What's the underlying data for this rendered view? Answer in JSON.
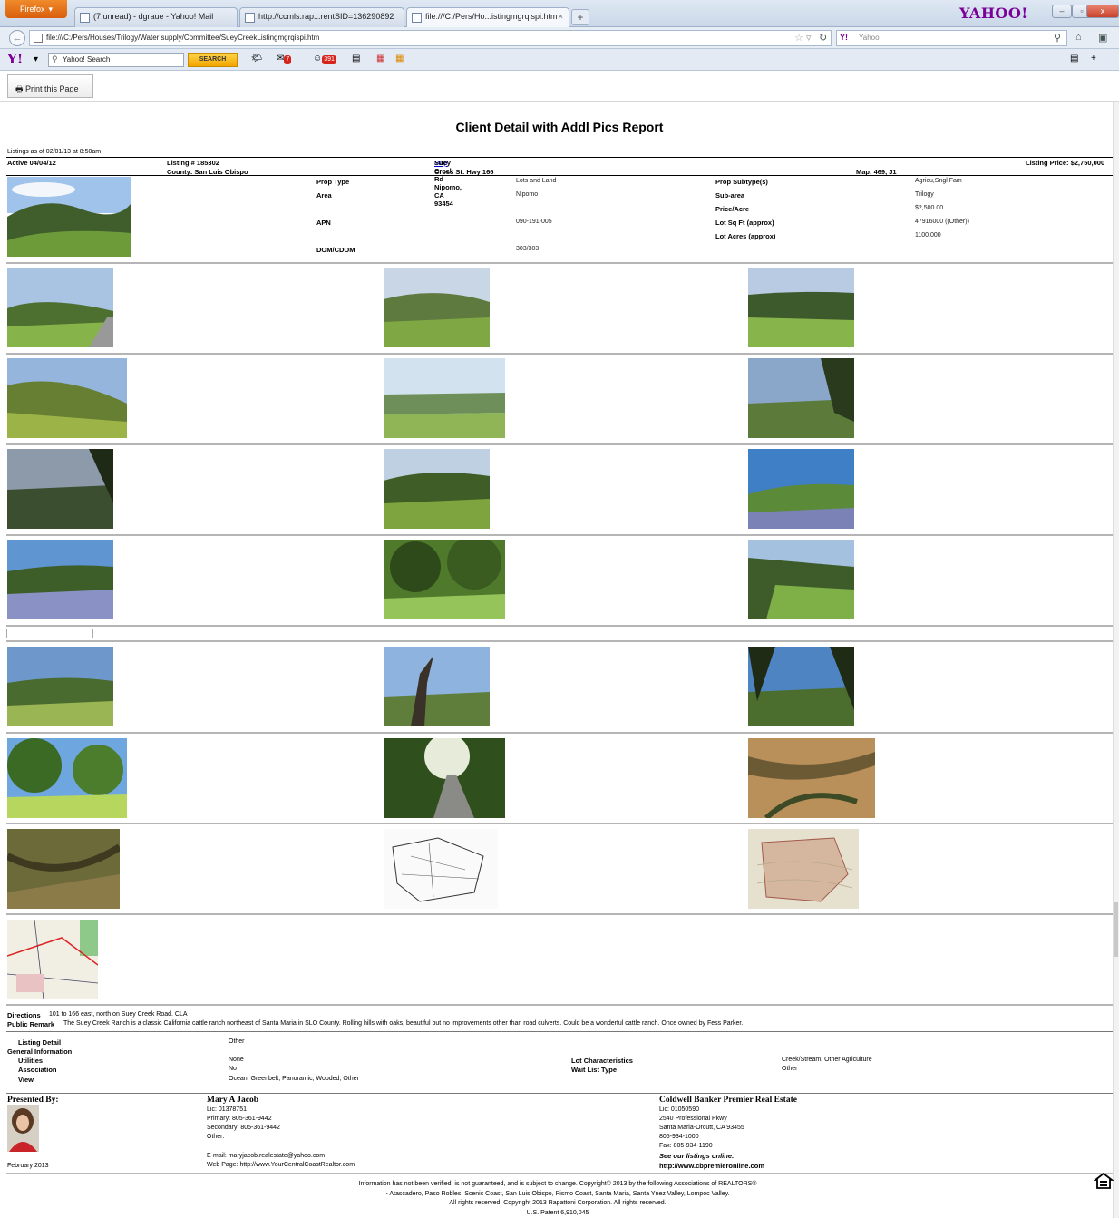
{
  "browser": {
    "firefox_label": "Firefox",
    "tabs": [
      {
        "label": "(7 unread) - dgraue - Yahoo! Mail"
      },
      {
        "label": "http://ccmls.rap...rentSID=136290892"
      },
      {
        "label": "file:///C:/Pers/Ho...istingmgrqispi.htm"
      }
    ],
    "new_tab": "+",
    "brand": "YAHOO!",
    "window_controls": {
      "minimize": "–",
      "restore": "▫",
      "close": "x"
    },
    "url": "file:///C:/Pers/Houses/Trilogy/Water supply/Committee/SueyCreekListingmgrqispi.htm",
    "search_placeholder": "Yahoo",
    "search_prefix": "Y!"
  },
  "yahoo_toolbar": {
    "logo": "Y!",
    "search_value": "Yahoo! Search",
    "search_button": "SEARCH",
    "mail_badge": "7",
    "count_badge": "391"
  },
  "print_button": "Print this Page",
  "report": {
    "title": "Client Detail with Addl Pics Report",
    "as_of": "Listings as of 02/01/13 at 8:50am",
    "status": "Active 04/04/12",
    "listing_no": "Listing # 185302",
    "county": "County: San Luis Obispo",
    "address": "Suey Creek Rd Nipomo, CA 93454",
    "map_link": "Map",
    "cross_st": "Cross St: Hwy 166",
    "map_ref": "Map: 469, J1",
    "price": "Listing Price: $2,750,000"
  },
  "details": {
    "left": [
      {
        "label": "Prop Type",
        "value": "Lots and Land"
      },
      {
        "label": "Area",
        "value": "Nipomo"
      },
      {
        "label": "APN",
        "value": "090-191-005"
      },
      {
        "label": "DOM/CDOM",
        "value": "303/303"
      }
    ],
    "right": [
      {
        "label": "Prop Subtype(s)",
        "value": "Agricu,Sngl Fam"
      },
      {
        "label": "Sub-area",
        "value": "Trilogy"
      },
      {
        "label": "Price/Acre",
        "value": "$2,500.00"
      },
      {
        "label": "Lot Sq Ft (approx)",
        "value": "47916000 ((Other))"
      },
      {
        "label": "Lot Acres (approx)",
        "value": "1100.000"
      }
    ]
  },
  "remarks": {
    "directions_label": "Directions",
    "directions": "101 to 166 east, north on Suey Creek Road. CLA",
    "public_label": "Public Remark",
    "public": "The Suey Creek Ranch is a classic California cattle ranch northeast of Santa Maria in SLO County. Rolling hills with oaks, beautiful but no improvements other than road culverts. Could be a wonderful cattle ranch. Once owned by Fess Parker."
  },
  "listing_detail": {
    "heading": "Listing Detail",
    "heading_value": "Other",
    "general": "General Information",
    "utilities_label": "Utilities",
    "utilities": "None",
    "association_label": "Association",
    "association": "No",
    "view_label": "View",
    "view": "Ocean, Greenbelt, Panoramic, Wooded, Other",
    "lot_char_label": "Lot Characteristics",
    "lot_char": "Creek/Stream, Other Agriculture",
    "wait_list_label": "Wait List Type",
    "wait_list": "Other"
  },
  "agent": {
    "presented_by": "Presented By:",
    "date": "February 2013",
    "name": "Mary A Jacob",
    "lic": "Lic: 01378751",
    "primary": "Primary: 805-361-9442",
    "secondary": "Secondary: 805-361-9442",
    "other": "Other:",
    "email": "E-mail: maryjacob.realestate@yahoo.com",
    "web": "Web Page: http://www.YourCentralCoastRealtor.com"
  },
  "office": {
    "name": "Coldwell Banker Premier Real Estate",
    "lic": "Lic: 01050590",
    "addr1": "2540 Professional Pkwy",
    "addr2": "Santa Maria-Orcutt, CA 93455",
    "phone": "805-934-1000",
    "fax": "Fax:  805-934-1190",
    "see": "See our listings online:",
    "url": "http://www.cbpremieronline.com"
  },
  "footer": {
    "line1": "Information has not been verified, is not guaranteed, and is subject to change. Copyright© 2013 by the following Associations of REALTORS®",
    "line2": "- Atascadero, Paso Robles, Scenic Coast, San Luis Obispo, Pismo Coast, Santa Maria, Santa Ynez Valley, Lompoc Valley.",
    "line3": "All rights reserved. Copyright 2013 Rapattoni Corporation. All rights reserved.",
    "line4": "U.S. Patent 6,910,045"
  }
}
